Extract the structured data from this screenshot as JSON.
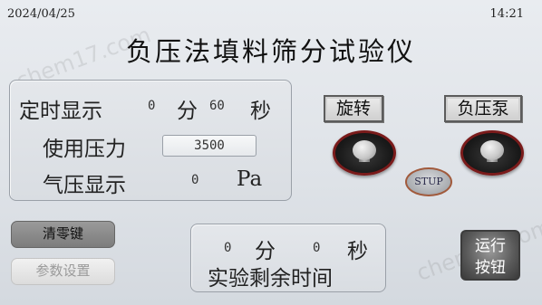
{
  "status": {
    "date": "2024/04/25",
    "time": "14:21"
  },
  "title": "负压法填料筛分试验仪",
  "timer_panel": {
    "timer_label": "定时显示",
    "min_value": "0",
    "min_unit": "分",
    "sec_value": "60",
    "sec_unit": "秒",
    "pressure_label": "使用压力",
    "pressure_value": "3500",
    "air_label": "气压显示",
    "air_value": "0",
    "air_unit": "Pa"
  },
  "buttons": {
    "rotate": "旋转",
    "vacuum_pump": "负压泵",
    "stup": "STUP",
    "clear": "清零键",
    "params": "参数设置",
    "run_line1": "运行",
    "run_line2": "按钮"
  },
  "remaining": {
    "min_value": "0",
    "min_unit": "分",
    "sec_value": "0",
    "sec_unit": "秒",
    "label": "实验剩余时间"
  },
  "colors": {
    "background": "#e3e6ea",
    "knob_ring": "#7a1b1b",
    "clear_button": "#8c8c8c",
    "params_button": "#e9e9e9"
  }
}
